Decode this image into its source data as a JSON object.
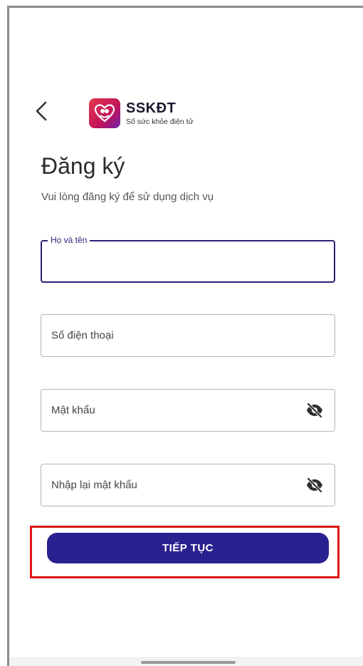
{
  "header": {
    "brand_name": "SSKĐT",
    "brand_subtitle": "Số sức khỏe điện tử",
    "back_icon": "chevron-left-icon",
    "logo_icon": "heart-hands-logo"
  },
  "page": {
    "title": "Đăng ký",
    "subtitle": "Vui lòng đăng ký để sử dụng dịch vụ"
  },
  "form": {
    "full_name": {
      "label": "Họ và tên",
      "value": ""
    },
    "phone": {
      "placeholder": "Số điện thoại"
    },
    "password": {
      "placeholder": "Mật khẩu",
      "toggle_icon": "eye-off-icon"
    },
    "confirm_password": {
      "placeholder": "Nhập lại mật khẩu",
      "toggle_icon": "eye-off-icon"
    }
  },
  "actions": {
    "continue_label": "TIẾP TỤC"
  },
  "colors": {
    "primary": "#2a2191",
    "focus_border": "#2a2276",
    "highlight": "#e01515",
    "logo_gradient_start": "#e23a4c",
    "logo_gradient_end": "#6b1fa8"
  }
}
